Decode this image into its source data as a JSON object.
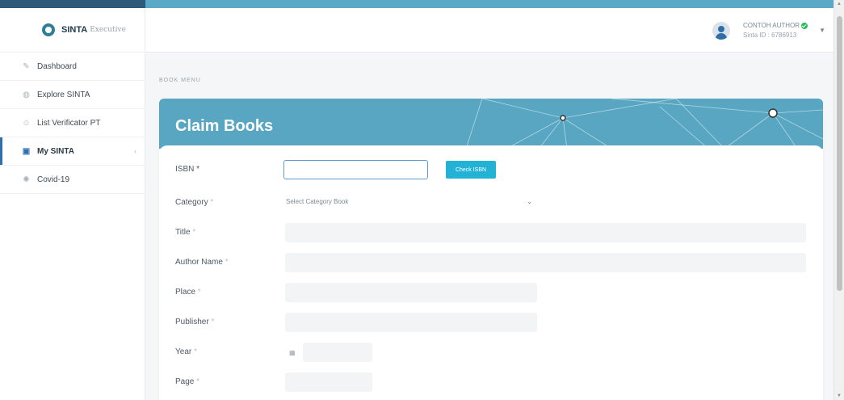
{
  "app": {
    "brand_name": "SINTA",
    "brand_sub": "Executive",
    "brand_color": "#2f7d97"
  },
  "sidebar": {
    "items": [
      {
        "label": "Dashboard",
        "icon": "pencil-icon",
        "active": false
      },
      {
        "label": "Explore SINTA",
        "icon": "globe-icon",
        "active": false
      },
      {
        "label": "List Verificator PT",
        "icon": "user-icon",
        "active": false
      },
      {
        "label": "My SINTA",
        "icon": "id-card-icon",
        "active": true
      },
      {
        "label": "Covid-19",
        "icon": "virus-icon",
        "active": false
      }
    ]
  },
  "header": {
    "user_name": "CONTOH AUTHOR",
    "user_id": "Sinta ID : 6786913",
    "verified_color": "#2dbb5f"
  },
  "breadcrumb": "BOOK MENU",
  "page": {
    "title": "Claim Books",
    "banner_color": "#58a6c2"
  },
  "form": {
    "isbn_label": "ISBN",
    "isbn_value": "",
    "check_button": "Check ISBN",
    "category_label": "Category",
    "category_selected": "Select Category Book",
    "title_label": "Title",
    "author_label": "Author Name",
    "place_label": "Place",
    "publisher_label": "Publisher",
    "year_label": "Year",
    "page_label": "Page",
    "required_mark": "*"
  }
}
